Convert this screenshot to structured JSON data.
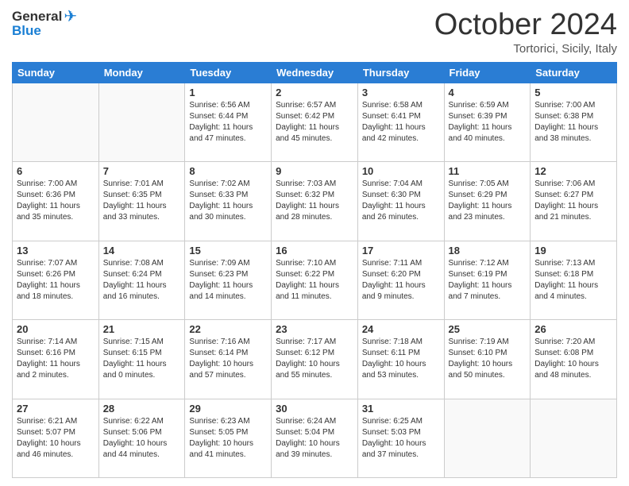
{
  "header": {
    "logo_general": "General",
    "logo_blue": "Blue",
    "title": "October 2024",
    "location": "Tortorici, Sicily, Italy"
  },
  "days_of_week": [
    "Sunday",
    "Monday",
    "Tuesday",
    "Wednesday",
    "Thursday",
    "Friday",
    "Saturday"
  ],
  "weeks": [
    [
      {
        "day": "",
        "info": ""
      },
      {
        "day": "",
        "info": ""
      },
      {
        "day": "1",
        "info": "Sunrise: 6:56 AM\nSunset: 6:44 PM\nDaylight: 11 hours and 47 minutes."
      },
      {
        "day": "2",
        "info": "Sunrise: 6:57 AM\nSunset: 6:42 PM\nDaylight: 11 hours and 45 minutes."
      },
      {
        "day": "3",
        "info": "Sunrise: 6:58 AM\nSunset: 6:41 PM\nDaylight: 11 hours and 42 minutes."
      },
      {
        "day": "4",
        "info": "Sunrise: 6:59 AM\nSunset: 6:39 PM\nDaylight: 11 hours and 40 minutes."
      },
      {
        "day": "5",
        "info": "Sunrise: 7:00 AM\nSunset: 6:38 PM\nDaylight: 11 hours and 38 minutes."
      }
    ],
    [
      {
        "day": "6",
        "info": "Sunrise: 7:00 AM\nSunset: 6:36 PM\nDaylight: 11 hours and 35 minutes."
      },
      {
        "day": "7",
        "info": "Sunrise: 7:01 AM\nSunset: 6:35 PM\nDaylight: 11 hours and 33 minutes."
      },
      {
        "day": "8",
        "info": "Sunrise: 7:02 AM\nSunset: 6:33 PM\nDaylight: 11 hours and 30 minutes."
      },
      {
        "day": "9",
        "info": "Sunrise: 7:03 AM\nSunset: 6:32 PM\nDaylight: 11 hours and 28 minutes."
      },
      {
        "day": "10",
        "info": "Sunrise: 7:04 AM\nSunset: 6:30 PM\nDaylight: 11 hours and 26 minutes."
      },
      {
        "day": "11",
        "info": "Sunrise: 7:05 AM\nSunset: 6:29 PM\nDaylight: 11 hours and 23 minutes."
      },
      {
        "day": "12",
        "info": "Sunrise: 7:06 AM\nSunset: 6:27 PM\nDaylight: 11 hours and 21 minutes."
      }
    ],
    [
      {
        "day": "13",
        "info": "Sunrise: 7:07 AM\nSunset: 6:26 PM\nDaylight: 11 hours and 18 minutes."
      },
      {
        "day": "14",
        "info": "Sunrise: 7:08 AM\nSunset: 6:24 PM\nDaylight: 11 hours and 16 minutes."
      },
      {
        "day": "15",
        "info": "Sunrise: 7:09 AM\nSunset: 6:23 PM\nDaylight: 11 hours and 14 minutes."
      },
      {
        "day": "16",
        "info": "Sunrise: 7:10 AM\nSunset: 6:22 PM\nDaylight: 11 hours and 11 minutes."
      },
      {
        "day": "17",
        "info": "Sunrise: 7:11 AM\nSunset: 6:20 PM\nDaylight: 11 hours and 9 minutes."
      },
      {
        "day": "18",
        "info": "Sunrise: 7:12 AM\nSunset: 6:19 PM\nDaylight: 11 hours and 7 minutes."
      },
      {
        "day": "19",
        "info": "Sunrise: 7:13 AM\nSunset: 6:18 PM\nDaylight: 11 hours and 4 minutes."
      }
    ],
    [
      {
        "day": "20",
        "info": "Sunrise: 7:14 AM\nSunset: 6:16 PM\nDaylight: 11 hours and 2 minutes."
      },
      {
        "day": "21",
        "info": "Sunrise: 7:15 AM\nSunset: 6:15 PM\nDaylight: 11 hours and 0 minutes."
      },
      {
        "day": "22",
        "info": "Sunrise: 7:16 AM\nSunset: 6:14 PM\nDaylight: 10 hours and 57 minutes."
      },
      {
        "day": "23",
        "info": "Sunrise: 7:17 AM\nSunset: 6:12 PM\nDaylight: 10 hours and 55 minutes."
      },
      {
        "day": "24",
        "info": "Sunrise: 7:18 AM\nSunset: 6:11 PM\nDaylight: 10 hours and 53 minutes."
      },
      {
        "day": "25",
        "info": "Sunrise: 7:19 AM\nSunset: 6:10 PM\nDaylight: 10 hours and 50 minutes."
      },
      {
        "day": "26",
        "info": "Sunrise: 7:20 AM\nSunset: 6:08 PM\nDaylight: 10 hours and 48 minutes."
      }
    ],
    [
      {
        "day": "27",
        "info": "Sunrise: 6:21 AM\nSunset: 5:07 PM\nDaylight: 10 hours and 46 minutes."
      },
      {
        "day": "28",
        "info": "Sunrise: 6:22 AM\nSunset: 5:06 PM\nDaylight: 10 hours and 44 minutes."
      },
      {
        "day": "29",
        "info": "Sunrise: 6:23 AM\nSunset: 5:05 PM\nDaylight: 10 hours and 41 minutes."
      },
      {
        "day": "30",
        "info": "Sunrise: 6:24 AM\nSunset: 5:04 PM\nDaylight: 10 hours and 39 minutes."
      },
      {
        "day": "31",
        "info": "Sunrise: 6:25 AM\nSunset: 5:03 PM\nDaylight: 10 hours and 37 minutes."
      },
      {
        "day": "",
        "info": ""
      },
      {
        "day": "",
        "info": ""
      }
    ]
  ]
}
